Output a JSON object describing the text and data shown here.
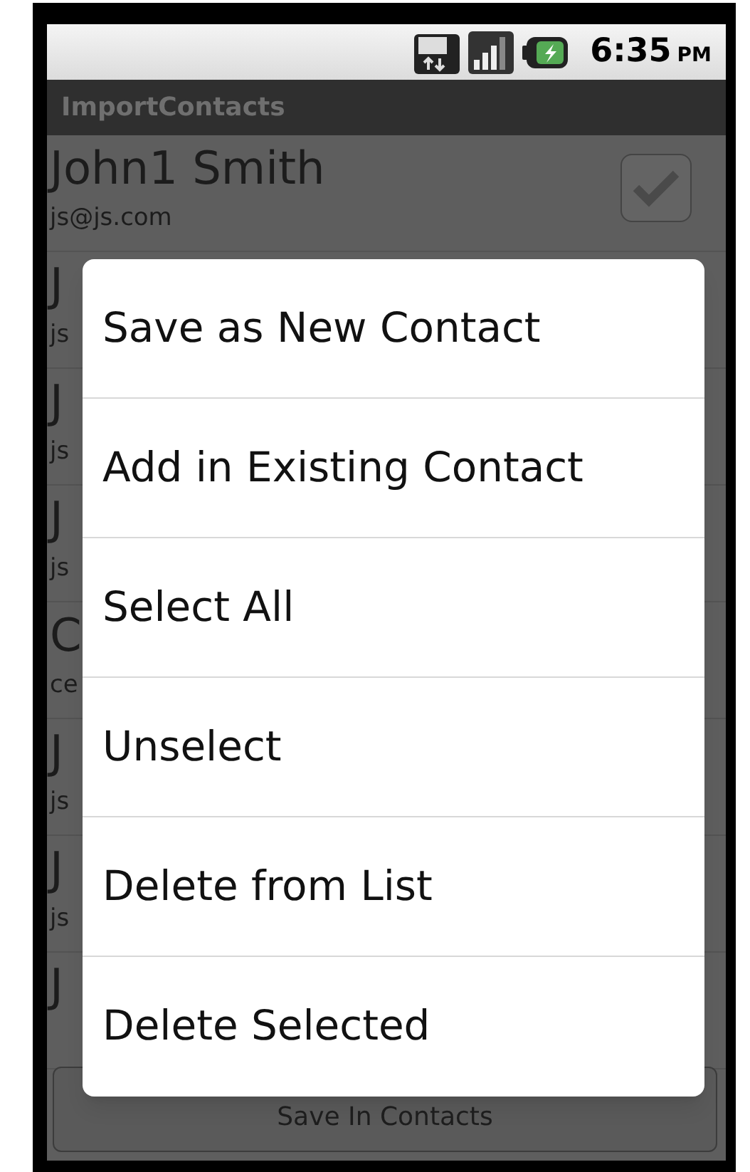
{
  "status_bar": {
    "time": "6:35",
    "meridiem": "PM"
  },
  "title": "ImportContacts",
  "contacts": [
    {
      "name": "John1 Smith",
      "email": "js@js.com",
      "checked": true
    },
    {
      "name": "J",
      "email": "js"
    },
    {
      "name": "J",
      "email": "js"
    },
    {
      "name": "J",
      "email": "js"
    },
    {
      "name": "C",
      "email": "ce"
    },
    {
      "name": "J",
      "email": "js"
    },
    {
      "name": "J",
      "email": "js"
    },
    {
      "name": "J"
    }
  ],
  "save_button": "Save In Contacts",
  "menu": [
    "Save as New Contact",
    "Add in Existing Contact",
    "Select All",
    "Unselect",
    "Delete from List",
    "Delete Selected"
  ]
}
